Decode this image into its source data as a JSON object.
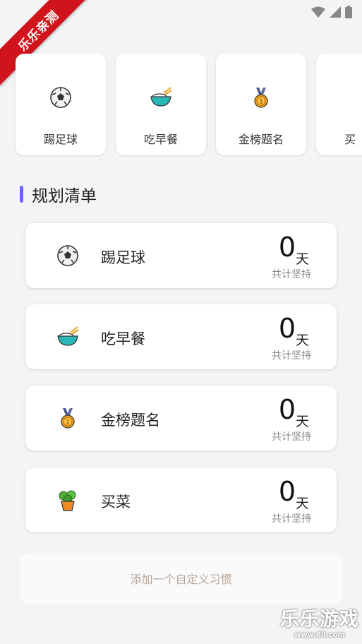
{
  "ribbon": "乐乐亲测",
  "top_habits": [
    {
      "label": "踢足球",
      "icon": "soccer-ball-icon"
    },
    {
      "label": "吃早餐",
      "icon": "rice-bowl-icon"
    },
    {
      "label": "金榜题名",
      "icon": "medal-icon"
    },
    {
      "label": "买",
      "icon": "plant-icon"
    }
  ],
  "section_title": "规划清单",
  "plans": [
    {
      "name": "踢足球",
      "days": "0",
      "unit": "天",
      "caption": "共计坚持",
      "icon": "soccer-ball-icon"
    },
    {
      "name": "吃早餐",
      "days": "0",
      "unit": "天",
      "caption": "共计坚持",
      "icon": "rice-bowl-icon"
    },
    {
      "name": "金榜题名",
      "days": "0",
      "unit": "天",
      "caption": "共计坚持",
      "icon": "medal-icon"
    },
    {
      "name": "买菜",
      "days": "0",
      "unit": "天",
      "caption": "共计坚持",
      "icon": "plant-icon"
    }
  ],
  "add_button": "添加一个自定义习惯",
  "watermark": {
    "title": "乐乐游戏",
    "url": "www.6ll.com"
  },
  "colors": {
    "accent": "#6c63ff",
    "add_text": "#b8a69a",
    "ribbon": "#d0141b"
  }
}
